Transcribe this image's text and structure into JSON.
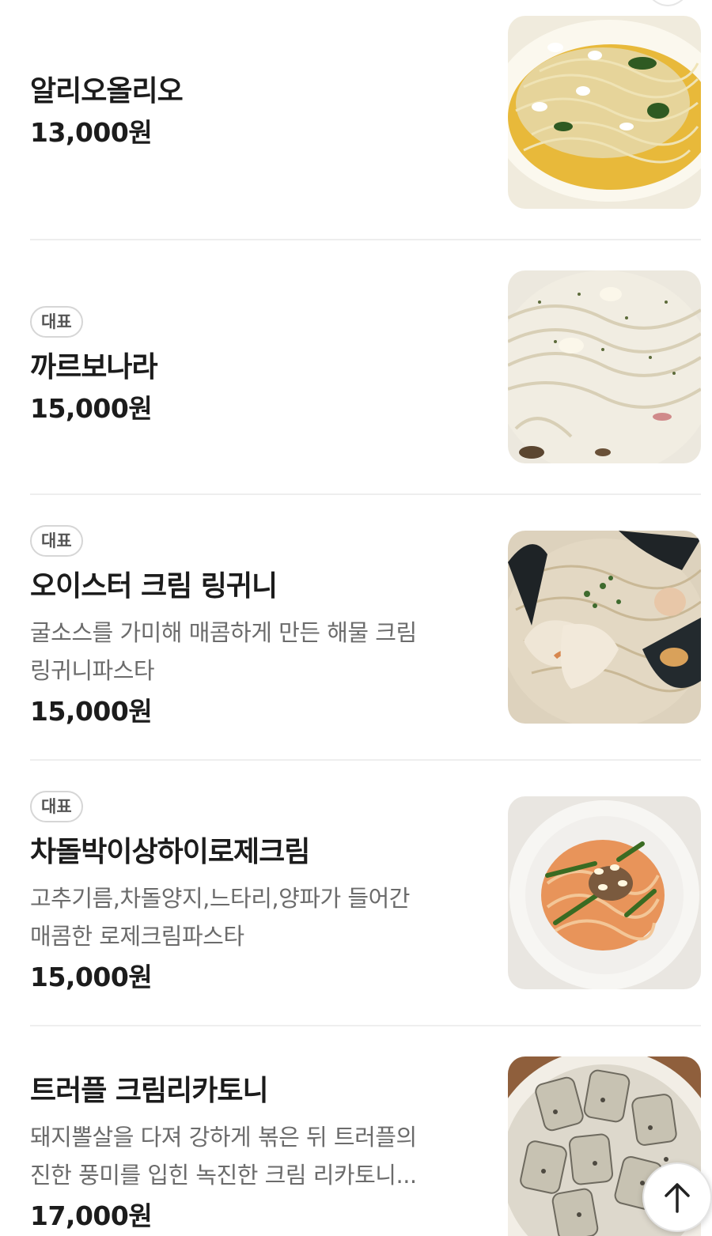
{
  "menu": {
    "badge_label": "대표",
    "items": [
      {
        "name": "알리오올리오",
        "price": "13,000원",
        "image_icon": "pasta-photo-aglio-olio"
      },
      {
        "badge": "대표",
        "name": "까르보나라",
        "price": "15,000원",
        "image_icon": "pasta-photo-carbonara"
      },
      {
        "badge": "대표",
        "name": "오이스터 크림 링귀니",
        "desc_lines": [
          "굴소스를 가미해 매콤하게 만든 해물 크림",
          "링귀니파스타"
        ],
        "price": "15,000원",
        "image_icon": "pasta-photo-oyster-cream-linguine"
      },
      {
        "badge": "대표",
        "name": "차돌박이상하이로제크림",
        "desc_lines": [
          "고추기름,차돌양지,느타리,양파가 들어간",
          "매콤한 로제크림파스타"
        ],
        "price": "15,000원",
        "image_icon": "pasta-photo-brisket-rose-cream"
      },
      {
        "name": "트러플 크림리카토니",
        "desc_lines": [
          "돼지뽈살을 다져 강하게 볶은 뒤 트러플의",
          "진한 풍미를 입힌 녹진한 크림 리카토니..."
        ],
        "price": "17,000원",
        "image_icon": "pasta-photo-truffle-rigatoni"
      }
    ]
  },
  "scroll_top": {
    "icon": "arrow-up-icon"
  }
}
